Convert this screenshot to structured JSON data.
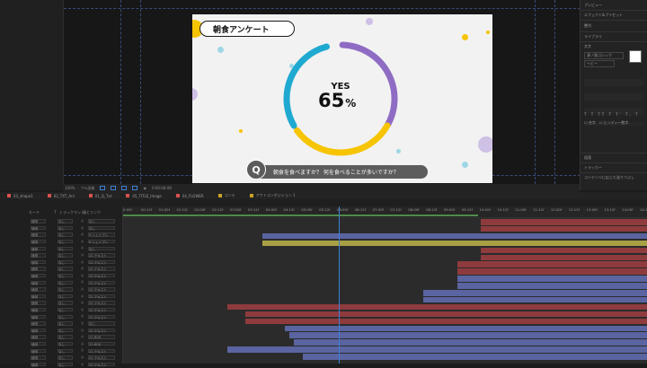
{
  "canvas": {
    "title": "朝食アンケート",
    "yes_label": "YES",
    "percent_value": "65",
    "percent_sign": "%",
    "q_badge": "Q",
    "question": "朝食を食べますか？ 何を食べることが多いですか？",
    "donut": {
      "yes_fraction": 0.65,
      "colors": {
        "purple": "#8f6cc4",
        "yellow": "#f6c400",
        "blue": "#1fa9d1"
      }
    }
  },
  "viewer_toolbar": [
    "100%",
    "フル画質",
    "0:00:08:08"
  ],
  "right_panel": {
    "items": [
      "プレビュー",
      "エフェクト&プリセット",
      "整列",
      "ライブラリ",
      "文字",
      "源ノ角ゴシック",
      "ヘビー",
      "段落",
      "トラッカー",
      "コンテンツに応じた塗りつぶし"
    ]
  },
  "tabs": [
    {
      "label": "03_shape1",
      "color": "#d9534f"
    },
    {
      "label": "02_TXT_Ani",
      "color": "#d9534f"
    },
    {
      "label": "01_Q_Txt",
      "color": "#d9534f"
    },
    {
      "label": "05_TITLE_Image",
      "color": "#d9534f"
    },
    {
      "label": "04_FLOWER",
      "color": "#d9534f"
    },
    {
      "label": "コンテ",
      "color": "#c9a227"
    },
    {
      "label": "アウトコンポジション 1",
      "color": "#c9a227"
    }
  ],
  "layer_header": {
    "mode": "モード",
    "t": "T",
    "trkmat": "トラックマット",
    "parent": "親とリンク"
  },
  "layers": [
    {
      "mode": "通常",
      "mat": "なし",
      "name": "なし"
    },
    {
      "mode": "通常",
      "mat": "なし",
      "name": "なし"
    },
    {
      "mode": "通常",
      "mat": "なし",
      "name": "9.シェイプレ"
    },
    {
      "mode": "通常",
      "mat": "なし",
      "name": "9.シェイプレ"
    },
    {
      "mode": "通常",
      "mat": "なし",
      "name": "なし"
    },
    {
      "mode": "通常",
      "mat": "なし",
      "name": "22.テキスト"
    },
    {
      "mode": "通常",
      "mat": "なし",
      "name": "22.テキスト"
    },
    {
      "mode": "通常",
      "mat": "なし",
      "name": "22.テキスト"
    },
    {
      "mode": "通常",
      "mat": "なし",
      "name": "22.テキスト"
    },
    {
      "mode": "通常",
      "mat": "なし",
      "name": "22.テキスト"
    },
    {
      "mode": "通常",
      "mat": "なし",
      "name": "22.テキスト"
    },
    {
      "mode": "通常",
      "mat": "なし",
      "name": "22.テキスト"
    },
    {
      "mode": "通常",
      "mat": "なし",
      "name": "22.テキスト"
    },
    {
      "mode": "通常",
      "mat": "なし",
      "name": "22.テキスト"
    },
    {
      "mode": "通常",
      "mat": "なし",
      "name": "22.テキスト"
    },
    {
      "mode": "通常",
      "mat": "なし",
      "name": "なし"
    },
    {
      "mode": "通常",
      "mat": "なし",
      "name": "22.テキスト"
    },
    {
      "mode": "通常",
      "mat": "なし",
      "name": "22.BOX"
    },
    {
      "mode": "通常",
      "mat": "なし",
      "name": "22.BOX"
    },
    {
      "mode": "通常",
      "mat": "なし",
      "name": "22.テキスト"
    },
    {
      "mode": "通常",
      "mat": "なし",
      "name": "22.テキスト"
    },
    {
      "mode": "通常",
      "mat": "なし",
      "name": "22.テキスト"
    }
  ],
  "ruler_ticks": [
    "0:00f",
    "00:12f",
    "01:00f",
    "01:12f",
    "02:00f",
    "02:12f",
    "03:00f",
    "03:12f",
    "04:00f",
    "04:12f",
    "05:00f",
    "05:12f",
    "06:00f",
    "06:12f",
    "07:00f",
    "07:12f",
    "08:00f",
    "08:12f",
    "09:00f",
    "09:12f",
    "10:00f",
    "10:12f",
    "11:00f",
    "11:12f",
    "12:00f",
    "12:12f",
    "13:00f",
    "13:12f",
    "14:00f",
    "14:12f"
  ],
  "track_colors": {
    "red": "#8f3b3e",
    "blue": "#5a64a0",
    "yellow": "#a9a046",
    "green": "#4f8a4a"
  }
}
